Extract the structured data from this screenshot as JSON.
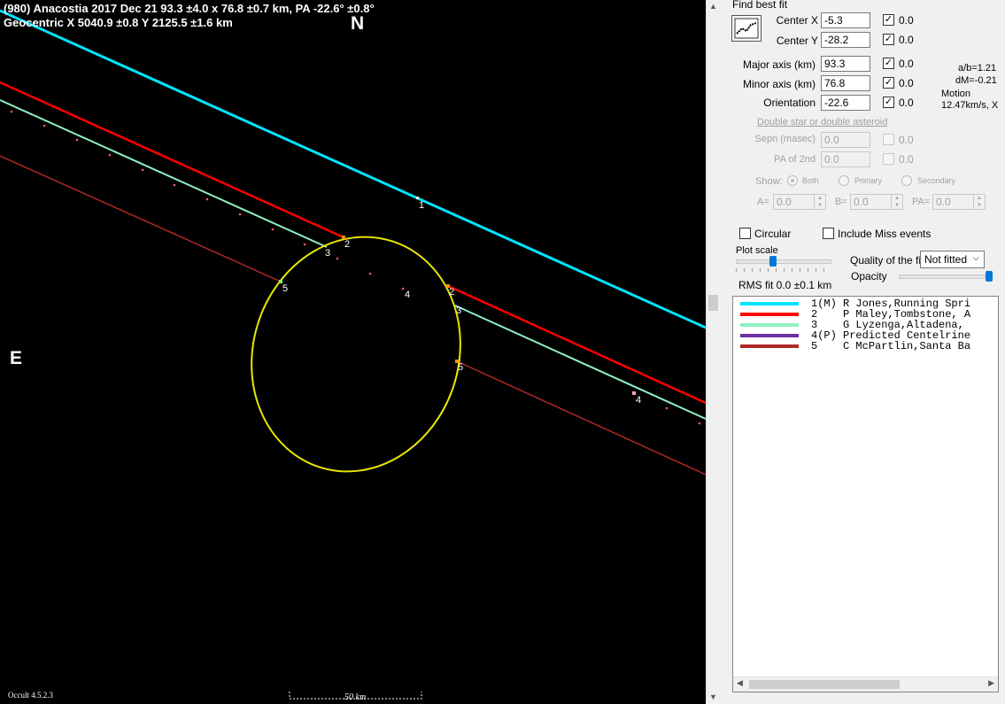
{
  "plot": {
    "title_line1": "(980) Anacostia  2017 Dec 21  93.3 ±4.0 x 76.8 ±0.7 km, PA -22.6° ±0.8°",
    "title_line2": "Geocentric  X  5040.9 ±0.8  Y 2125.5 ±1.6 km",
    "north_label": "N",
    "east_label": "E",
    "version": "Occult 4.5.2.3",
    "scale_label": "50 km",
    "chord_labels": [
      "1",
      "2",
      "3",
      "2",
      "3",
      "4",
      "5",
      "5",
      "4"
    ]
  },
  "colors": {
    "chord1": "#00e5ff",
    "chord2": "#ff0000",
    "chord3": "#8ff0c0",
    "chord4": "#7030a0",
    "chord5": "#b02828",
    "ellipse": "#e8e800"
  },
  "panel": {
    "find_best_fit": "Find best fit",
    "fit_button_icon": "fit-chart-icon",
    "params": [
      {
        "label": "Center X",
        "value": "-5.3",
        "checked": true,
        "delta": "0.0"
      },
      {
        "label": "Center Y",
        "value": "-28.2",
        "checked": true,
        "delta": "0.0"
      },
      {
        "label": "Major axis (km)",
        "value": "93.3",
        "checked": true,
        "delta": "0.0"
      },
      {
        "label": "Minor axis (km)",
        "value": "76.8",
        "checked": true,
        "delta": "0.0"
      },
      {
        "label": "Orientation",
        "value": "-22.6",
        "checked": true,
        "delta": "0.0"
      }
    ],
    "ab_ratio": "a/b=1.21",
    "dm": "dM=-0.21",
    "motion_label": "Motion",
    "motion_value": "12.47km/s, X",
    "double_star": "Double star  or  double asteroid",
    "sepn_label": "Sepn (masec)",
    "sepn_value": "0.0",
    "sepn_delta": "0.0",
    "pa2_label": "PA of 2nd",
    "pa2_value": "0.0",
    "pa2_delta": "0.0",
    "show_label": "Show:",
    "show_options": [
      "Both",
      "Primary",
      "Secondary"
    ],
    "a_label": "A=",
    "a_value": "0.0",
    "b_label": "B=",
    "b_value": "0.0",
    "pa_label": "PA=",
    "pa_value": "0.0",
    "circular_label": "Circular",
    "include_miss_label": "Include Miss events",
    "plot_scale_label": "Plot scale",
    "quality_label": "Quality of the fit",
    "quality_value": "Not fitted",
    "opacity_label": "Opacity",
    "rms_fit": "RMS fit  0.0 ±0.1 km"
  },
  "legend": [
    {
      "num": "1(M)",
      "text": "R Jones,Running Spri",
      "color": "#00e5ff"
    },
    {
      "num": "2",
      "text": "P Maley,Tombstone, A",
      "color": "#ff0000"
    },
    {
      "num": "3",
      "text": "G Lyzenga,Altadena,",
      "color": "#8ff0c0"
    },
    {
      "num": "4(P)",
      "text": "Predicted Centelrine",
      "color": "#7030a0"
    },
    {
      "num": "5",
      "text": "C McPartlin,Santa Ba",
      "color": "#b02828"
    }
  ]
}
